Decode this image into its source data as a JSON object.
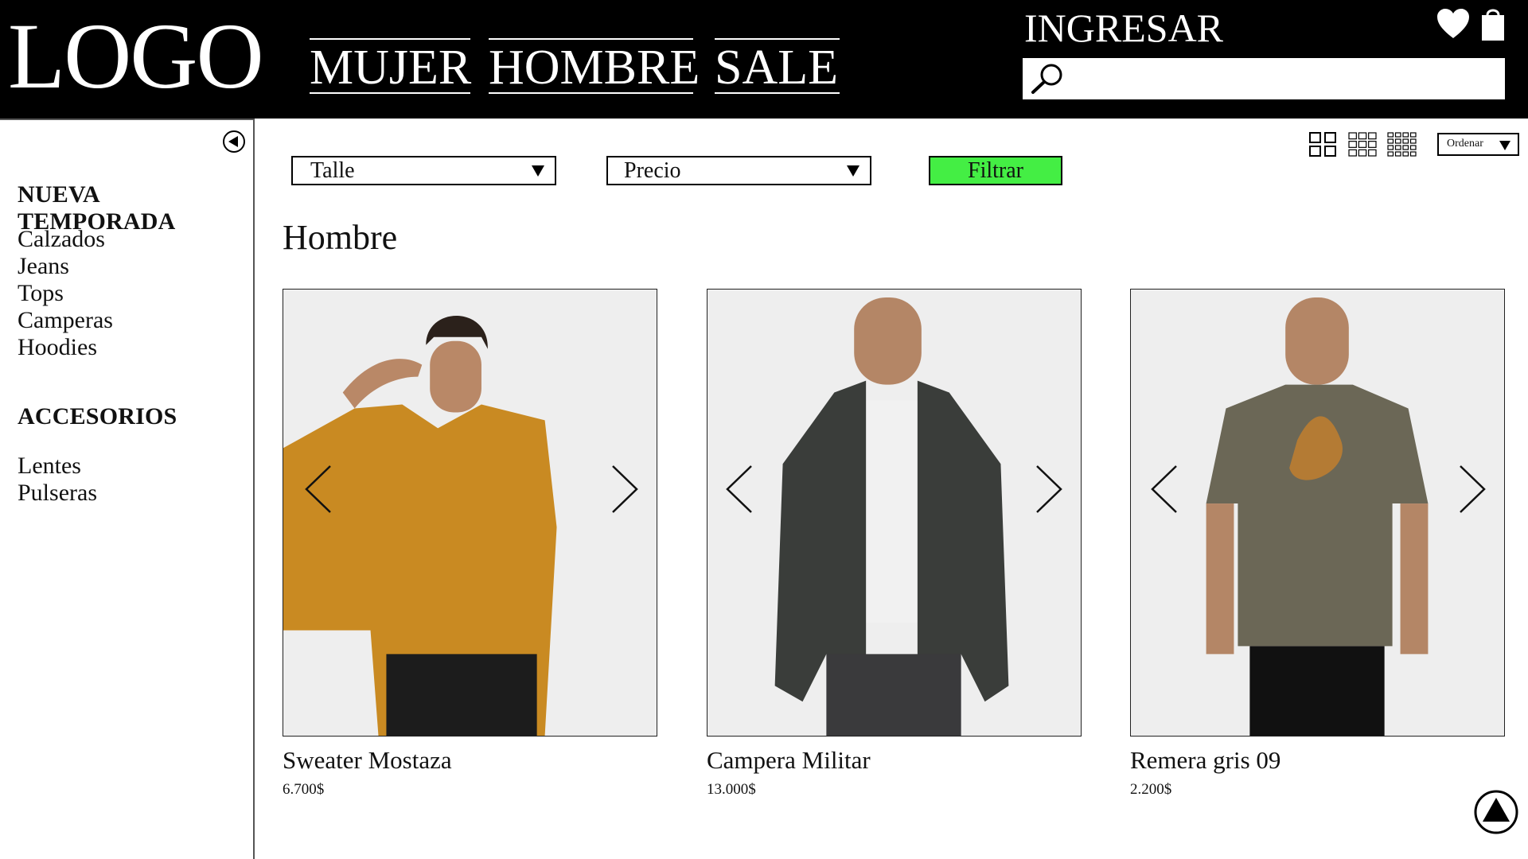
{
  "header": {
    "logo": "LOGO",
    "nav": [
      "MUJER",
      "HOMBRE",
      "SALE"
    ],
    "login": "INGRESAR",
    "search": {
      "value": "",
      "placeholder": ""
    }
  },
  "sidebar": {
    "sections": [
      {
        "title": "NUEVA TEMPORADA",
        "items": [
          "Calzados",
          "Jeans",
          "Tops",
          "Camperas",
          "Hoodies"
        ]
      },
      {
        "title": "ACCESORIOS",
        "items": [
          "Lentes",
          "Pulseras"
        ]
      }
    ]
  },
  "filters": {
    "size_label": "Talle",
    "price_label": "Precio",
    "filter_button": "Filtrar",
    "filter_button_color": "#44ee44"
  },
  "toolbar": {
    "sort_label": "Ordenar",
    "view_options": [
      "grid-2x2-icon",
      "grid-3x3-icon",
      "grid-4x4-icon"
    ]
  },
  "page": {
    "title": "Hombre"
  },
  "products": [
    {
      "name": "Sweater Mostaza",
      "price": "6.700$",
      "garment_color": "#c98a22"
    },
    {
      "name": "Campera  Militar",
      "price": "13.000$",
      "garment_color": "#3a3d3a"
    },
    {
      "name": "Remera gris 09",
      "price": "2.200$",
      "garment_color": "#6b6756"
    }
  ],
  "colors": {
    "header_bg": "#000000",
    "header_text": "#ffffff"
  }
}
